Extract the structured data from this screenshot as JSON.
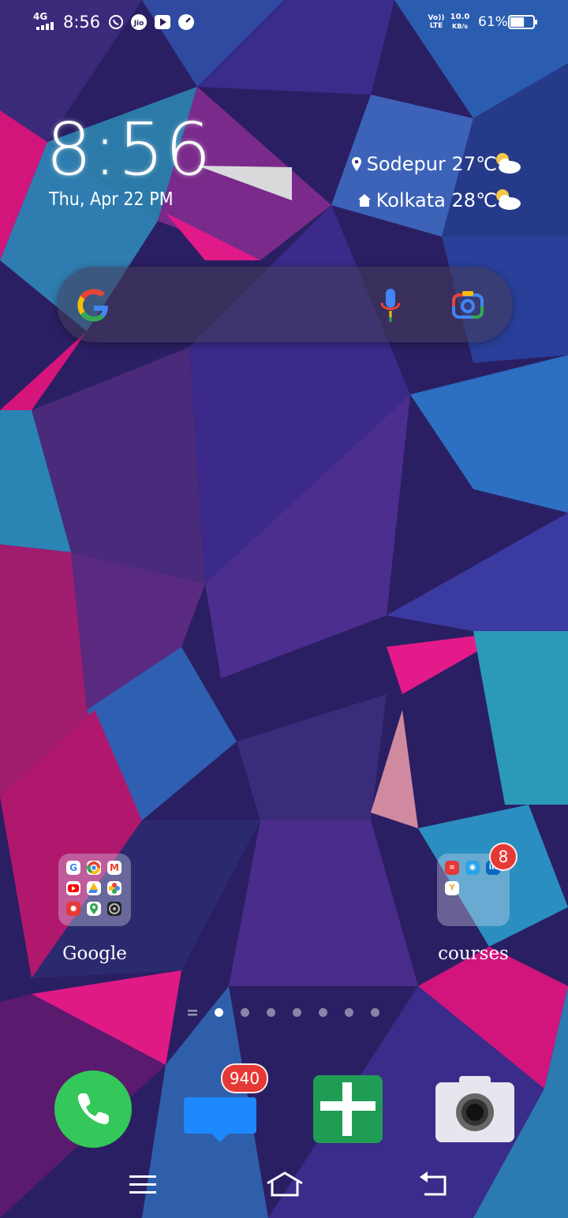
{
  "status_bar": {
    "network": "4G",
    "time": "8:56",
    "volte": "Vo)) LTE",
    "speed": "10.0",
    "speed_unit": "KB/s",
    "battery_percent": "61%",
    "battery_level": 0.61,
    "icons": [
      "signal-icon",
      "whatsapp-icon",
      "jio-icon",
      "youtube-icon",
      "speed-icon",
      "battery-icon"
    ]
  },
  "clock_widget": {
    "time": "8:56",
    "date": "Thu, Apr 22 PM"
  },
  "weather": [
    {
      "location": "Sodepur 27℃",
      "icon": "location-pin-icon",
      "condition_icon": "partly-cloudy-icon"
    },
    {
      "location": "Kolkata 28℃",
      "icon": "home-icon",
      "condition_icon": "partly-cloudy-icon"
    }
  ],
  "search": {
    "icons": [
      "google-logo-icon",
      "microphone-icon",
      "google-lens-icon"
    ]
  },
  "folders": [
    {
      "label": "Google",
      "badge": ""
    },
    {
      "label": "courses",
      "badge": "8"
    }
  ],
  "page_indicator": {
    "pages": 7,
    "current": 1
  },
  "dock": [
    {
      "name": "Phone",
      "badge": ""
    },
    {
      "name": "Messages",
      "badge": "940"
    },
    {
      "name": "Sheets",
      "badge": ""
    },
    {
      "name": "Camera",
      "badge": ""
    }
  ],
  "colors": {
    "accent_red": "#e53935",
    "phone_green": "#34c759",
    "messages_blue": "#1e88ff",
    "sheets_green": "#1f9d55"
  }
}
